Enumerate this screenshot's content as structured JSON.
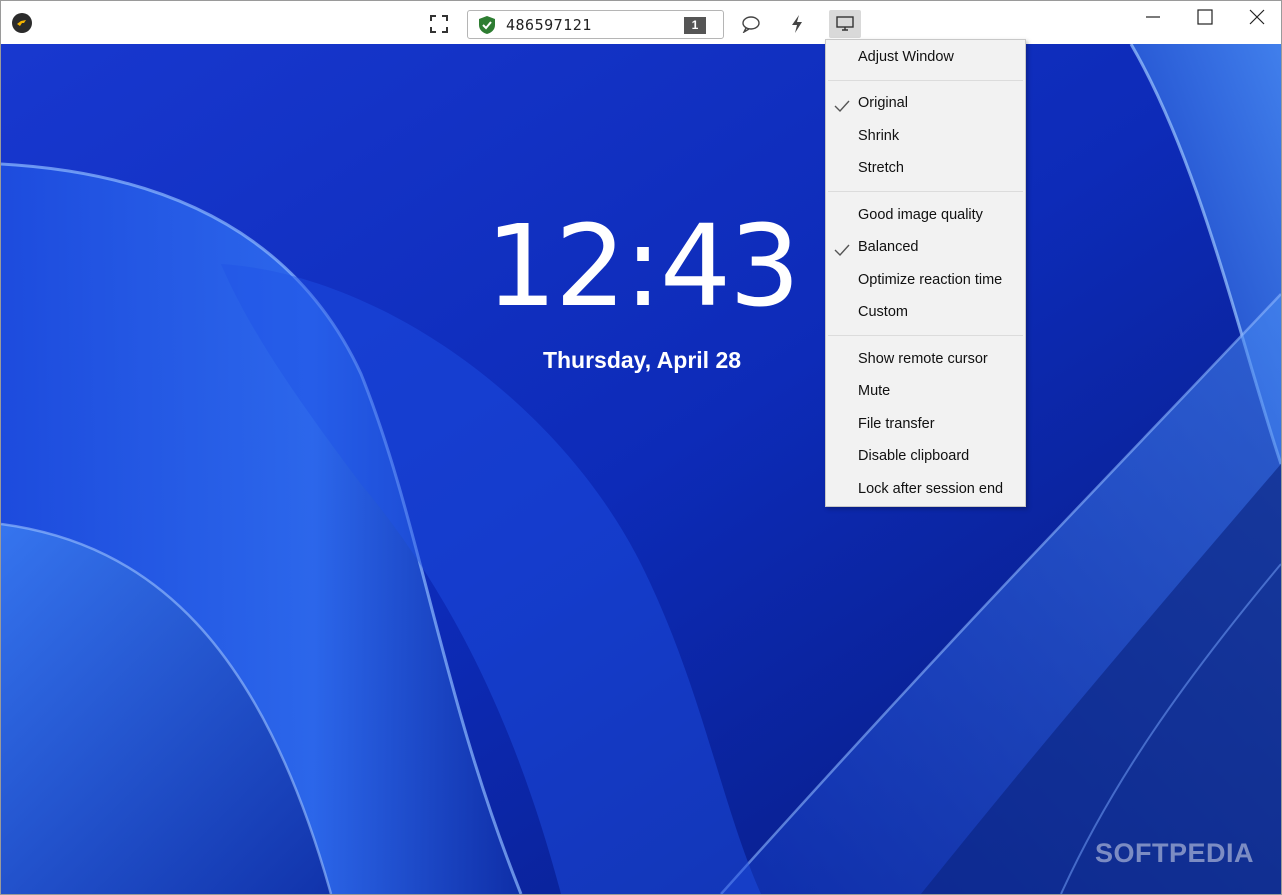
{
  "titlebar": {
    "connection_id": "486597121",
    "session_badge": "1",
    "icons": {
      "logo": "app-logo-icon",
      "fullscreen": "fullscreen-icon",
      "shield": "shield-check-icon",
      "chat": "chat-bubble-icon",
      "actions": "lightning-icon",
      "display": "monitor-icon",
      "minimize": "minimize-icon",
      "maximize": "maximize-icon",
      "close": "close-icon"
    }
  },
  "desktop": {
    "time": "12:43",
    "date": "Thursday, April 28",
    "watermark": "SOFTPEDIA"
  },
  "menu": {
    "items": [
      {
        "label": "Adjust Window",
        "checked": false
      },
      {
        "label": "Original",
        "checked": true
      },
      {
        "label": "Shrink",
        "checked": false
      },
      {
        "label": "Stretch",
        "checked": false
      },
      {
        "label": "Good image quality",
        "checked": false
      },
      {
        "label": "Balanced",
        "checked": true
      },
      {
        "label": "Optimize reaction time",
        "checked": false
      },
      {
        "label": "Custom",
        "checked": false
      },
      {
        "label": "Show remote cursor",
        "checked": false
      },
      {
        "label": "Mute",
        "checked": false
      },
      {
        "label": "File transfer",
        "checked": false
      },
      {
        "label": "Disable clipboard",
        "checked": false
      },
      {
        "label": "Lock after session end",
        "checked": false
      }
    ]
  },
  "colors": {
    "wallpaper_base": "#0e2fc4",
    "shield_green": "#2e7d32",
    "menu_bg": "#f2f2f2"
  }
}
